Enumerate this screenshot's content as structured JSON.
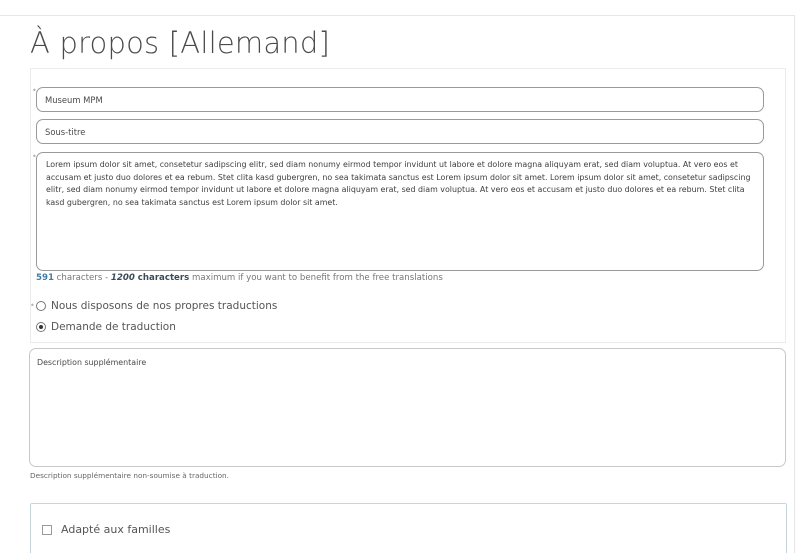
{
  "section": {
    "title": "À propos [Allemand]"
  },
  "form": {
    "required_marker": "•",
    "name_value": "Museum MPM",
    "subtitle_placeholder": "Sous-titre",
    "description_value": "Lorem ipsum dolor sit amet, consetetur sadipscing elitr, sed diam nonumy eirmod tempor invidunt ut labore et dolore magna aliquyam erat, sed diam voluptua. At vero eos et accusam et justo duo dolores et ea rebum. Stet clita kasd gubergren, no sea takimata sanctus est Lorem ipsum dolor sit amet. Lorem ipsum dolor sit amet, consetetur sadipscing elitr, sed diam nonumy eirmod tempor invidunt ut labore et dolore magna aliquyam erat, sed diam voluptua. At vero eos et accusam et justo duo dolores et ea rebum. Stet clita kasd gubergren, no sea takimata sanctus est Lorem ipsum dolor sit amet.",
    "counter": {
      "count": "591",
      "text1": " characters - ",
      "max": "1200",
      "text2": " characters",
      "text3": " maximum if you want to benefit from the free translations"
    },
    "translation_options": [
      {
        "label": "Nous disposons de nos propres traductions",
        "checked": false
      },
      {
        "label": "Demande de traduction",
        "checked": true
      }
    ],
    "additional_description_placeholder": "Description supplémentaire",
    "additional_description_help": "Description supplémentaire non-soumise à traduction.",
    "family_checkbox_label": "Adapté aux familles",
    "family_checked": false
  }
}
